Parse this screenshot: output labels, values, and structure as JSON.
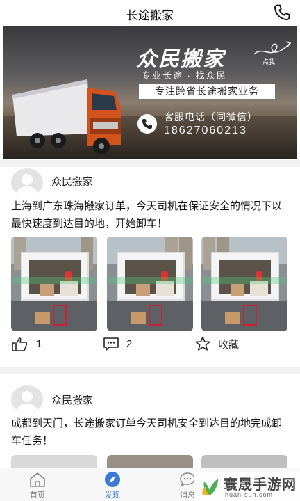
{
  "header": {
    "title": "长途搬家",
    "phone_icon": "phone-icon"
  },
  "banner": {
    "brand": "众民搬家",
    "slogan": "专业长途 · 找众民",
    "tagline": "专注跨省长途搬家业务",
    "click_hint": "点我",
    "service_label": "客服电话（同微信）",
    "phone_number": "18627060213"
  },
  "posts": [
    {
      "author": "众民搬家",
      "content": "上海到广东珠海搬家订单，今天司机在保证安全的情况下以最快速度到达目的地，开始卸车！",
      "like_count": "1",
      "comment_count": "2",
      "favorite_label": "收藏"
    },
    {
      "author": "众民搬家",
      "content": "成都到天门，长途搬家订单今天司机安全到达目的地完成卸车任务！"
    }
  ],
  "tabbar": {
    "items": [
      {
        "label": "首页",
        "icon": "home-icon"
      },
      {
        "label": "发现",
        "icon": "compass-icon"
      },
      {
        "label": "消息",
        "icon": "chat-icon"
      }
    ],
    "active_color": "#3a7bd5"
  },
  "watermark": {
    "name": "寰晟手游网",
    "domain": "huan-sun.com"
  }
}
